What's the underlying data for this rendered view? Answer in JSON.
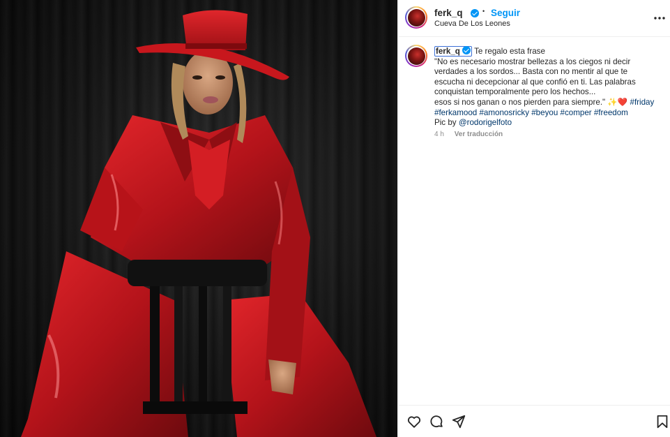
{
  "post": {
    "username": "ferk_q",
    "follow_label": "Seguir",
    "separator": "•",
    "location": "Cueva De Los Leones"
  },
  "caption": {
    "username": "ferk_q",
    "lines": [
      "Te regalo esta frase",
      "\"No es necesario mostrar bellezas a los ciegos ni decir",
      "verdades a los sordos... Basta con no mentir al que te",
      "escucha ni decepcionar al que confió en ti. Las palabras",
      "conquistan temporalmente pero los hechos...",
      "esos si nos ganan o nos pierden para siempre.\""
    ],
    "emoji": "✨❤️",
    "hashtags_line1": "#friday",
    "hashtags_line2": [
      "#ferkamood",
      "#amonosricky",
      "#beyou",
      "#comper",
      "#freedom"
    ],
    "credit_prefix": "Pic by",
    "credit_handle": "@rodorigelfoto",
    "time": "4 h",
    "translate_label": "Ver traducción"
  },
  "icons": {
    "verified": "verified-badge-icon",
    "more": "more-options-icon",
    "like": "heart-icon",
    "comment": "comment-icon",
    "share": "share-icon",
    "save": "bookmark-icon"
  },
  "colors": {
    "link_blue": "#0095f6",
    "hashtag": "#00376b",
    "coat_red": "#c4161c"
  }
}
